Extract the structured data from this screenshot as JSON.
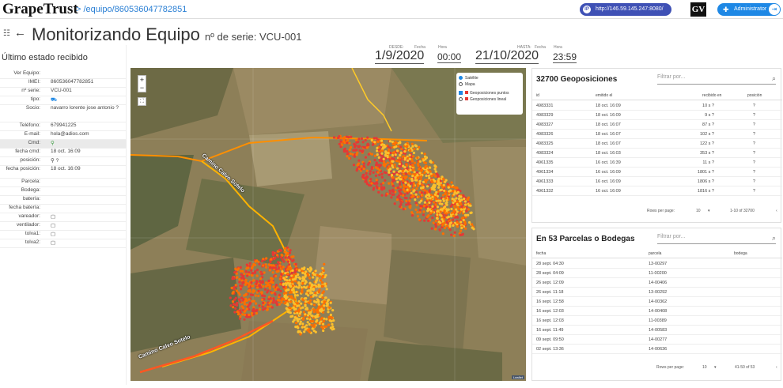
{
  "header": {
    "brand": "GrapeTrust",
    "breadcrumb": "> /equipo/860536047782851",
    "server_url": "http://146.59.145.247:8080/",
    "badge": "GV",
    "user_role": "Administrator"
  },
  "page": {
    "title": "Monitorizando Equipo",
    "serial_label": "nº de serie: VCU-001"
  },
  "sidebar": {
    "heading": "Último estado recibido",
    "rows": [
      {
        "k": "Ver Equipo:",
        "v": ""
      },
      {
        "k": "IMEI:",
        "v": "860536047782851"
      },
      {
        "k": "nº serie:",
        "v": "VCU-001"
      },
      {
        "k": "tipo:",
        "v": ""
      },
      {
        "k": "Socio:",
        "v": "navarro lorente jose antonio ?"
      },
      {
        "k": "Teléfono:",
        "v": "679941225"
      },
      {
        "k": "E-mail:",
        "v": "hola@adios.com"
      },
      {
        "k": "Cmd:",
        "v": ""
      },
      {
        "k": "fecha cmd:",
        "v": "18 oct. 16:09"
      },
      {
        "k": "posición:",
        "v": ""
      },
      {
        "k": "fecha posición:",
        "v": "18 oct. 16:09"
      },
      {
        "k": "Parcela:",
        "v": ""
      },
      {
        "k": "Bodega:",
        "v": ""
      },
      {
        "k": "batería:",
        "v": ""
      },
      {
        "k": "fecha batería:",
        "v": ""
      },
      {
        "k": "vareador:",
        "v": ""
      },
      {
        "k": "ventilador:",
        "v": ""
      },
      {
        "k": "tolva1:",
        "v": ""
      },
      {
        "k": "tolva2:",
        "v": ""
      }
    ]
  },
  "range": {
    "from_label": "DESDE:",
    "to_label": "HASTA:",
    "fecha_label": "Fecha",
    "hora_label": "Hora",
    "from_date": "1/9/2020",
    "from_time": "00:00",
    "to_date": "21/10/2020",
    "to_time": "23:59"
  },
  "map": {
    "layers": {
      "satellite": "Satélite",
      "map": "Mapa",
      "points": "Geoposiciones puntos",
      "linear": "Geoposiciones lineal"
    },
    "road_label": "Camino Calvo Sotelo",
    "road_label_2": "Camino Calvo Sotelo",
    "attribution": "Leaflet",
    "colors": {
      "red": "#e53935",
      "orange": "#ff6f00",
      "yellow": "#fbc02d",
      "field": "#8c7d57"
    }
  },
  "geopos": {
    "title": "32700 Geoposiciones",
    "filter_placeholder": "Filtrar por...",
    "columns": [
      "id",
      "emitido el",
      "recibido en",
      "posición"
    ],
    "rows": [
      {
        "id": "4983331",
        "emitido": "18 oct. 16:09",
        "recibido": "10 s ?",
        "pos": "?"
      },
      {
        "id": "4983329",
        "emitido": "18 oct. 16:09",
        "recibido": "9 s ?",
        "pos": "?"
      },
      {
        "id": "4983327",
        "emitido": "18 oct. 16:07",
        "recibido": "87 s ?",
        "pos": "?"
      },
      {
        "id": "4983326",
        "emitido": "18 oct. 16:07",
        "recibido": "102 s ?",
        "pos": "?"
      },
      {
        "id": "4983325",
        "emitido": "18 oct. 16:07",
        "recibido": "122 s ?",
        "pos": "?"
      },
      {
        "id": "4983324",
        "emitido": "18 oct. 16:03",
        "recibido": "353 s ?",
        "pos": "?"
      },
      {
        "id": "4961335",
        "emitido": "16 oct. 16:39",
        "recibido": "11 s ?",
        "pos": "?"
      },
      {
        "id": "4961334",
        "emitido": "16 oct. 16:09",
        "recibido": "1801 s ?",
        "pos": "?"
      },
      {
        "id": "4961333",
        "emitido": "16 oct. 16:09",
        "recibido": "1806 s ?",
        "pos": "?"
      },
      {
        "id": "4961332",
        "emitido": "16 oct. 16:09",
        "recibido": "1816 s ?",
        "pos": "?"
      }
    ],
    "rows_per_page_label": "Rows per page:",
    "rows_per_page": "10",
    "range": "1-10 of 32700"
  },
  "parcels": {
    "title": "En 53 Parcelas o Bodegas",
    "filter_placeholder": "Filtrar por...",
    "columns": [
      "fecha",
      "parcela",
      "bodega"
    ],
    "rows": [
      {
        "fecha": "28 sept. 04:30",
        "parcela": "13-00297",
        "bodega": ""
      },
      {
        "fecha": "28 sept. 04:09",
        "parcela": "11-00200",
        "bodega": ""
      },
      {
        "fecha": "26 sept. 12:09",
        "parcela": "14-00406",
        "bodega": ""
      },
      {
        "fecha": "26 sept. 11:18",
        "parcela": "13-00292",
        "bodega": ""
      },
      {
        "fecha": "16 sept. 12:58",
        "parcela": "14-00362",
        "bodega": ""
      },
      {
        "fecha": "16 sept. 12:03",
        "parcela": "14-00408",
        "bodega": ""
      },
      {
        "fecha": "16 sept. 12:03",
        "parcela": "11-00389",
        "bodega": ""
      },
      {
        "fecha": "16 sept. 11:49",
        "parcela": "14-00583",
        "bodega": ""
      },
      {
        "fecha": "09 sept. 09:50",
        "parcela": "14-00277",
        "bodega": ""
      },
      {
        "fecha": "02 sept. 13:36",
        "parcela": "14-00636",
        "bodega": ""
      }
    ],
    "rows_per_page_label": "Rows per page:",
    "rows_per_page": "10",
    "range": "41-50 of 53"
  }
}
